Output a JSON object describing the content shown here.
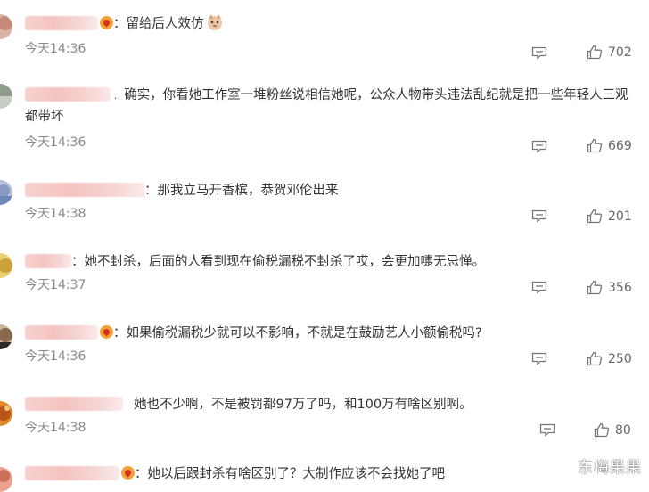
{
  "comments": [
    {
      "text": "留给后人效仿",
      "time": "今天14:36",
      "likes": "702"
    },
    {
      "text": "确实，你看她工作室一堆粉丝说相信她呢，公众人物带头违法乱纪就是把一些年轻人三观",
      "text2": "都带坏",
      "time": "今天14:36",
      "likes": "669"
    },
    {
      "text": "那我立马开香槟，恭贺邓伦出来",
      "time": "今天14:38",
      "likes": "201"
    },
    {
      "text": "她不封杀，后面的人看到现在偷税漏税不封杀了哎，会更加嚏无忌惮。",
      "time": "今天14:37",
      "likes": "356"
    },
    {
      "text": "如果偷税漏税少就可以不影响，不就是在鼓励艺人小额偷税吗?",
      "time": "今天14:36",
      "likes": "250"
    },
    {
      "text": "她也不少啊，不是被罚都97万了吗，和100万有啥区别啊。",
      "time": "今天14:38",
      "likes": "80"
    },
    {
      "text": "她以后跟封杀有啥区别了？大制作应该不会找她了吧"
    }
  ],
  "separator": "：",
  "watermark": "东梅果果"
}
